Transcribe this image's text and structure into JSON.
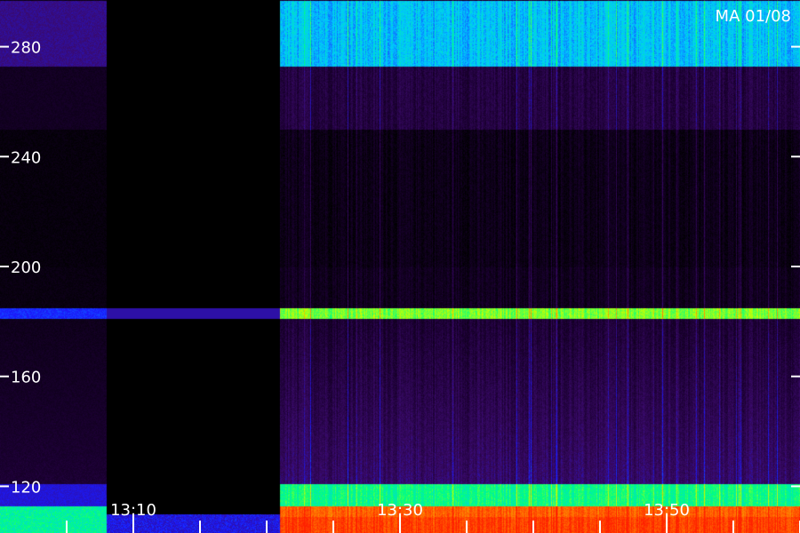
{
  "station_label": "MA 01/08",
  "chart_data": {
    "type": "heatmap",
    "title": "",
    "xlabel": "",
    "ylabel": "",
    "ylim": [
      103,
      297
    ],
    "y_ticks": [
      120,
      160,
      200,
      240,
      280
    ],
    "y_tick_labels": [
      "120",
      "160",
      "200",
      "240",
      "280"
    ],
    "x_ticks": [
      "13:10",
      "13:30",
      "13:50"
    ],
    "data_gap": {
      "from": "13:08",
      "to": "13:21"
    },
    "bands": [
      {
        "name": "strong-band",
        "y_from": 103,
        "y_to": 113,
        "level": 0.92
      },
      {
        "name": "mid-band",
        "y_from": 113,
        "y_to": 121,
        "level": 0.62
      },
      {
        "name": "narrow-line",
        "y_from": 181,
        "y_to": 185,
        "level": 0.7
      },
      {
        "name": "upper-band",
        "y_from": 273,
        "y_to": 297,
        "level": 0.5
      }
    ],
    "colors": {
      "background": "#000000",
      "colormap": [
        "#000000",
        "#1a0030",
        "#3a0a6a",
        "#1a1aff",
        "#00c8ff",
        "#00ff80",
        "#c8ff00",
        "#ff8000",
        "#ff2000"
      ],
      "axis": "#ffffff",
      "time_label": "#ffffff"
    }
  }
}
